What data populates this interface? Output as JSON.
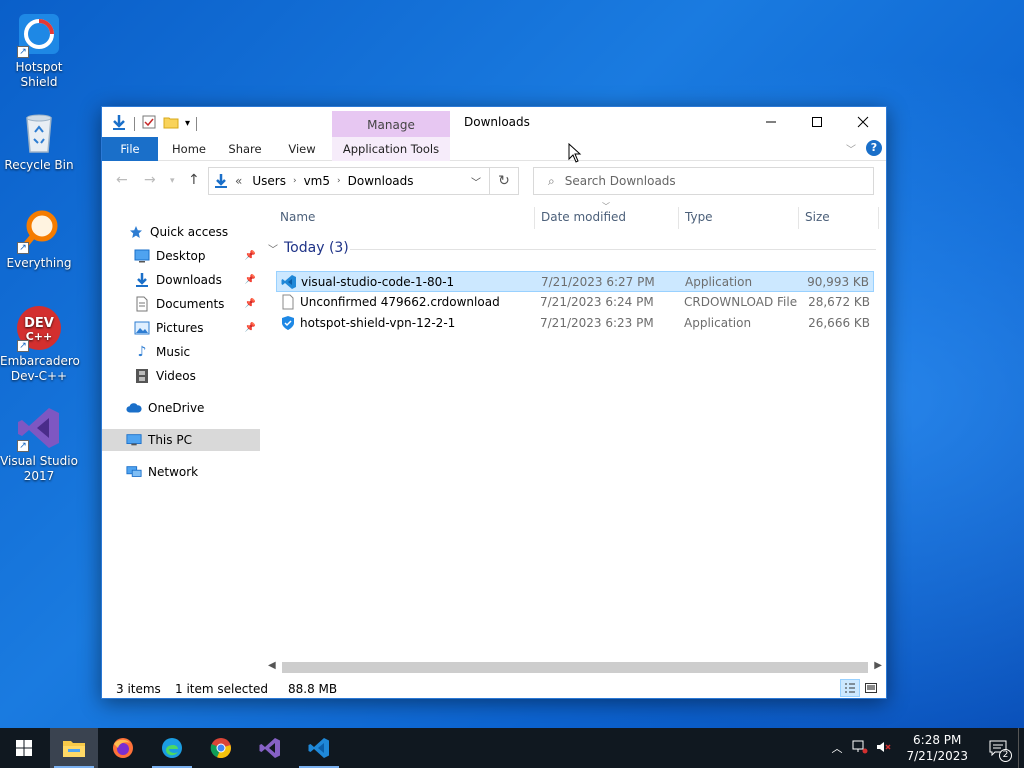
{
  "desktop": {
    "icons": [
      {
        "label": "Hotspot Shield"
      },
      {
        "label": "Recycle Bin"
      },
      {
        "label": "Everything"
      },
      {
        "label": "Embarcadero Dev-C++"
      },
      {
        "label": "Visual Studio 2017"
      }
    ]
  },
  "window": {
    "title": "Downloads",
    "manage_tab": "Manage",
    "ribbon_tabs": [
      "File",
      "Home",
      "Share",
      "View",
      "Application Tools"
    ],
    "address": {
      "overflow": "«",
      "crumbs": [
        "Users",
        "vm5",
        "Downloads"
      ]
    },
    "search": {
      "placeholder": "Search Downloads"
    },
    "nav": {
      "items": [
        {
          "label": "Quick access"
        },
        {
          "label": "Desktop"
        },
        {
          "label": "Downloads"
        },
        {
          "label": "Documents"
        },
        {
          "label": "Pictures"
        },
        {
          "label": "Music"
        },
        {
          "label": "Videos"
        },
        {
          "label": "OneDrive"
        },
        {
          "label": "This PC"
        },
        {
          "label": "Network"
        }
      ]
    },
    "columns": [
      "Name",
      "Date modified",
      "Type",
      "Size"
    ],
    "group": {
      "label": "Today (3)"
    },
    "files": [
      {
        "name": "visual-studio-code-1-80-1",
        "date": "7/21/2023 6:27 PM",
        "type": "Application",
        "size": "90,993 KB"
      },
      {
        "name": "Unconfirmed 479662.crdownload",
        "date": "7/21/2023 6:24 PM",
        "type": "CRDOWNLOAD File",
        "size": "28,672 KB"
      },
      {
        "name": "hotspot-shield-vpn-12-2-1",
        "date": "7/21/2023 6:23 PM",
        "type": "Application",
        "size": "26,666 KB"
      }
    ],
    "status": {
      "count": "3 items",
      "selected": "1 item selected",
      "size": "88.8 MB"
    }
  },
  "taskbar": {
    "time": "6:28 PM",
    "date": "7/21/2023",
    "notification_count": "2"
  },
  "colors": {
    "accent": "#1a6fc9",
    "selection": "#cce8ff",
    "manage_tab": "#e7c7f2"
  }
}
